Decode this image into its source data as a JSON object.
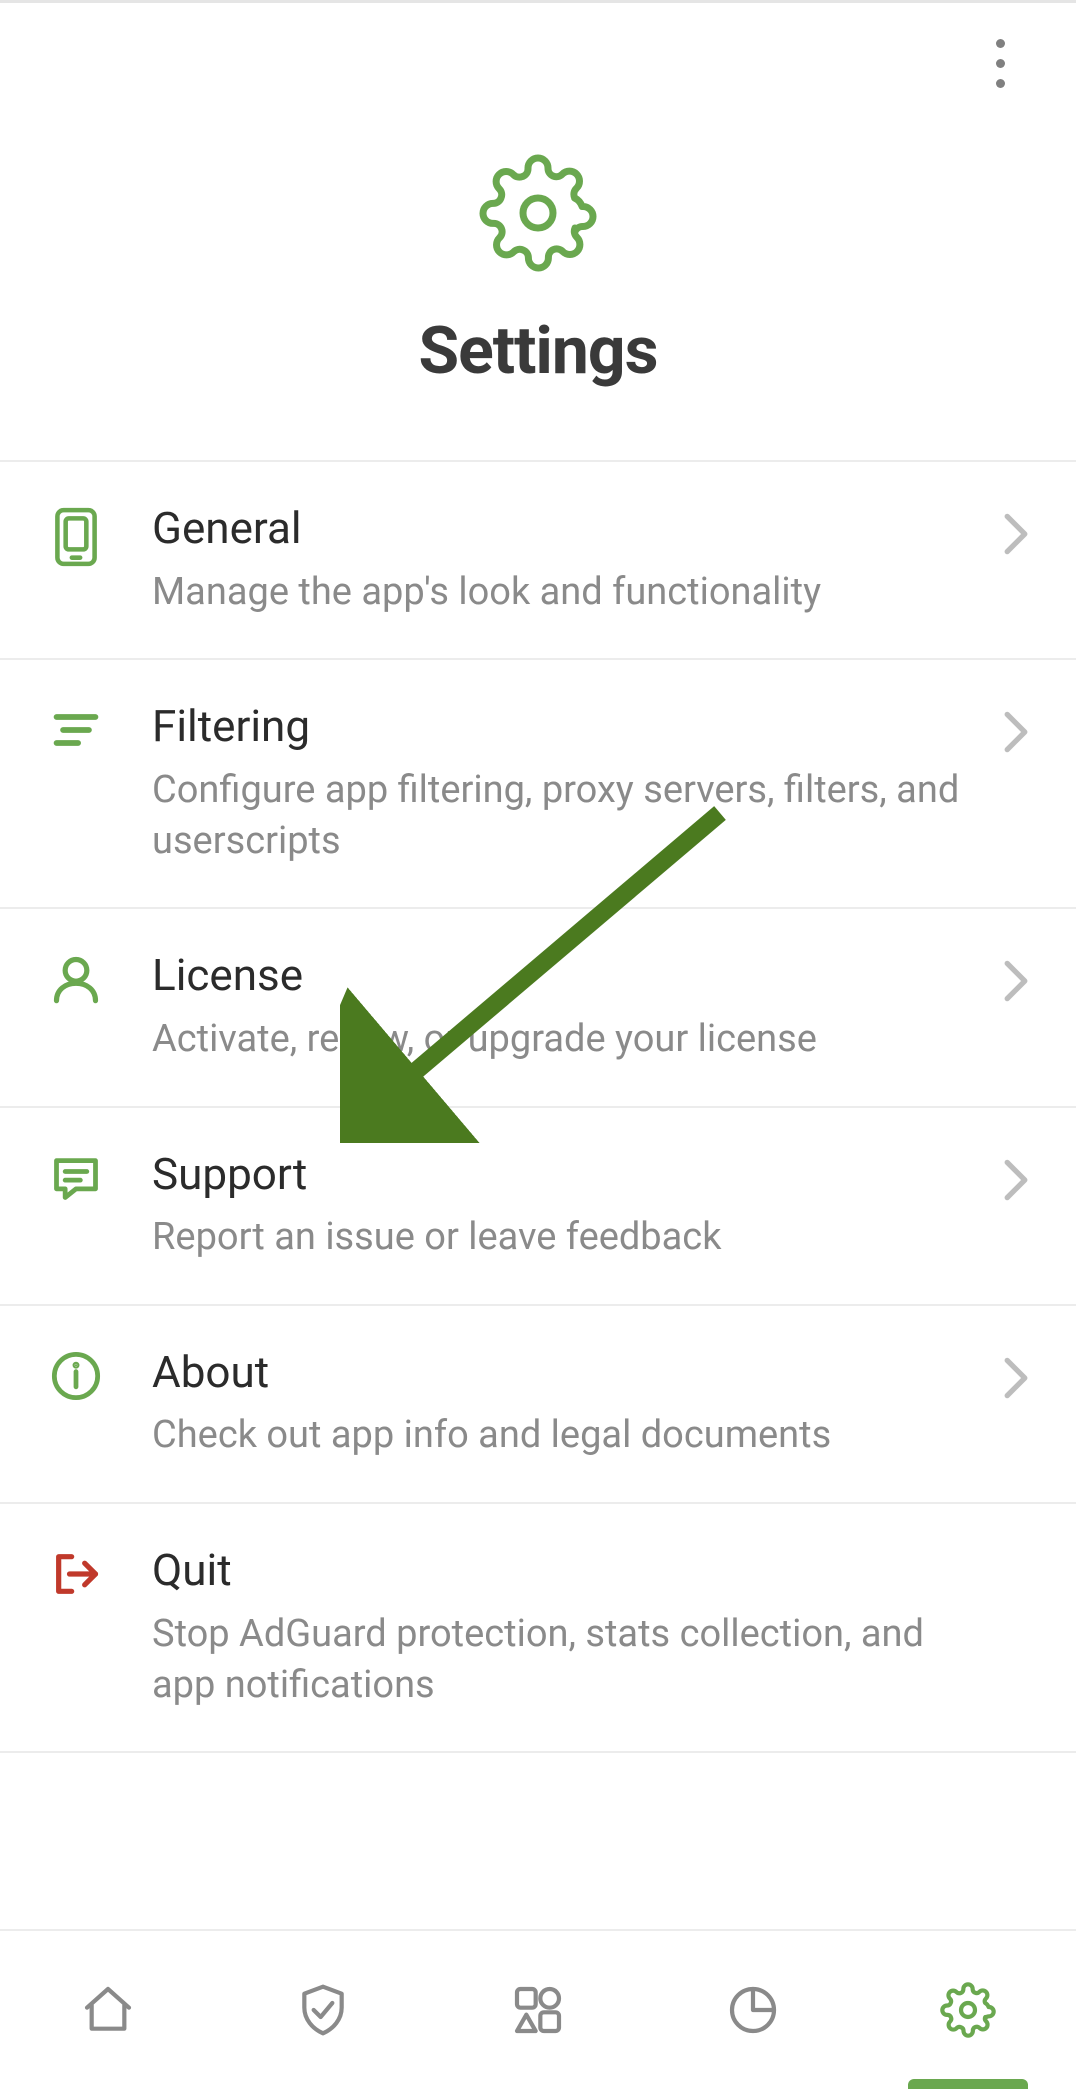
{
  "colors": {
    "accent": "#6aa84f",
    "danger": "#c0392b",
    "text": "#3a3a3a",
    "muted": "#8a8a8a"
  },
  "page": {
    "title": "Settings"
  },
  "items": [
    {
      "icon": "phone",
      "title": "General",
      "sub": "Manage the app's look and functionality",
      "chevron": true
    },
    {
      "icon": "filter",
      "title": "Filtering",
      "sub": "Configure app filtering, proxy servers, filters, and userscripts",
      "chevron": true
    },
    {
      "icon": "user",
      "title": "License",
      "sub": "Activate, renew, or upgrade your license",
      "chevron": true
    },
    {
      "icon": "chat",
      "title": "Support",
      "sub": "Report an issue or leave feedback",
      "chevron": true
    },
    {
      "icon": "info",
      "title": "About",
      "sub": "Check out app info and legal documents",
      "chevron": true
    },
    {
      "icon": "exit",
      "title": "Quit",
      "sub": "Stop AdGuard protection, stats collection, and app notifications",
      "chevron": false
    }
  ],
  "nav": [
    {
      "icon": "home",
      "active": false
    },
    {
      "icon": "shield",
      "active": false
    },
    {
      "icon": "apps",
      "active": false
    },
    {
      "icon": "stats",
      "active": false
    },
    {
      "icon": "gear",
      "active": true
    }
  ]
}
